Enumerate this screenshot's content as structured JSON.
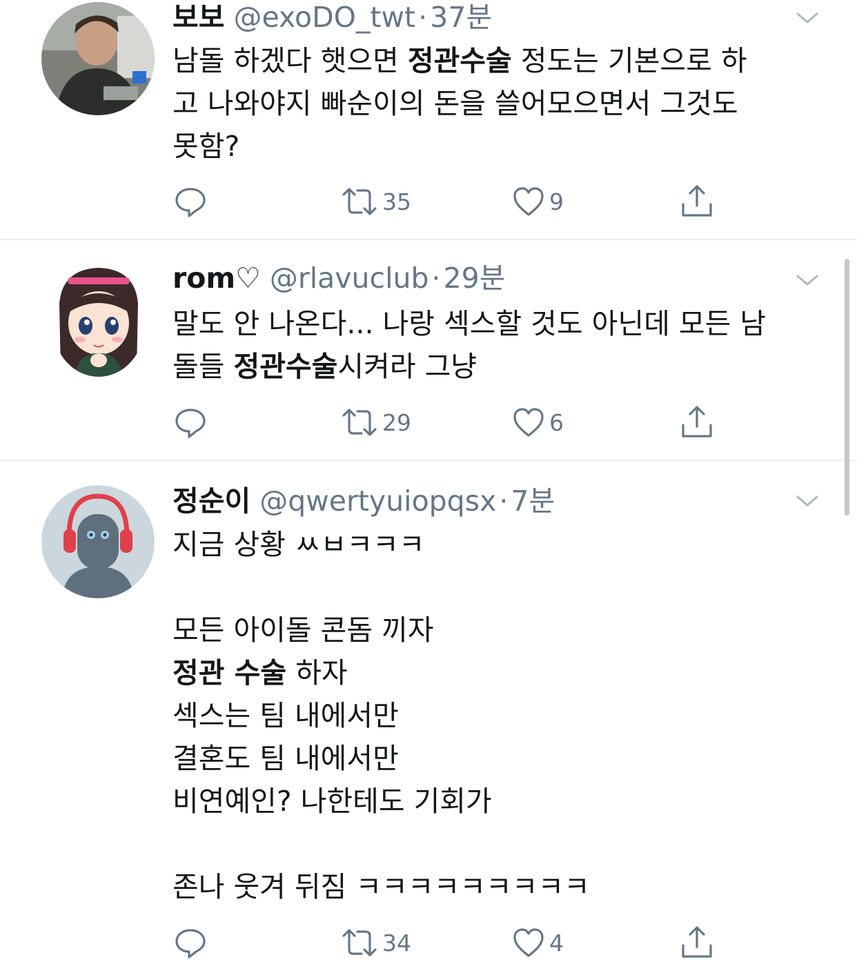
{
  "tweets": [
    {
      "name": "보보",
      "handle": "@exoDO_twt",
      "time": "37분",
      "body_html": "남돌 하겠다 햇으면 <b>정관수술</b> 정도는 기본으로 하\n고 나와야지 빠순이의 돈을 쓸어모으면서 그것도\n못함?",
      "retweets": "35",
      "likes": "9",
      "avatar": "photo-young-man"
    },
    {
      "name": "rom♡",
      "handle": "@rlavuclub",
      "time": "29분",
      "body_html": "말도 안 나온다... 나랑 섹스할 것도 아닌데 모든 남\n돌들 <b>정관수술</b>시켜라 그냥",
      "retweets": "29",
      "likes": "6",
      "avatar": "anime-girl"
    },
    {
      "name": "정순이",
      "handle": "@qwertyuiopqsx",
      "time": "7분",
      "body_html": "지금 상황 ㅆㅂㅋㅋㅋ\n\n모든 아이돌 콘돔 끼자\n<b>정관 수술</b> 하자\n섹스는 팀 내에서만\n결혼도 팀 내에서만\n비연예인? 나한테도 기회가\n\n존나 웃겨 뒤짐 ㅋㅋㅋㅋㅋㅋㅋㅋㅋ",
      "retweets": "34",
      "likes": "4",
      "avatar": "robot-headphones"
    }
  ],
  "icons": {
    "reply": "reply-icon",
    "retweet": "retweet-icon",
    "like": "heart-icon",
    "share": "share-icon",
    "menu": "chevron-down-icon"
  },
  "colors": {
    "text": "#14171a",
    "secondary": "#657786",
    "divider": "#e6ecf0"
  }
}
